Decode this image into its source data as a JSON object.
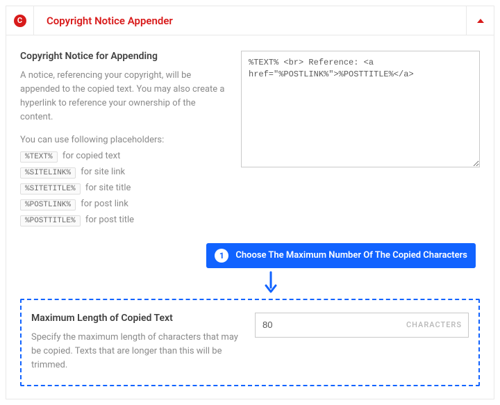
{
  "header": {
    "icon_letter": "C",
    "title": "Copyright Notice Appender"
  },
  "notice_section": {
    "title": "Copyright Notice for Appending",
    "desc": "A notice, referencing your copyright, will be appended to the copied text. You may also create a hyperlink to reference your ownership of the content.",
    "sub": "You can use following placeholders:",
    "placeholders": [
      {
        "tag": "%TEXT%",
        "label": "for copied text"
      },
      {
        "tag": "%SITELINK%",
        "label": "for site link"
      },
      {
        "tag": "%SITETITLE%",
        "label": "for site title"
      },
      {
        "tag": "%POSTLINK%",
        "label": "for post link"
      },
      {
        "tag": "%POSTTITLE%",
        "label": "for post title"
      }
    ],
    "textarea": "%TEXT% <br> Reference: <a href=\"%POSTLINK%\">%POSTTITLE%</a>"
  },
  "callout": {
    "num": "1",
    "text": "Choose The Maximum Number Of The Copied Characters"
  },
  "maxlen_section": {
    "title": "Maximum Length of Copied Text",
    "desc": "Specify the maximum length of characters that may be copied. Texts that are longer than this will be trimmed.",
    "value": "80",
    "unit": "CHARACTERS"
  }
}
